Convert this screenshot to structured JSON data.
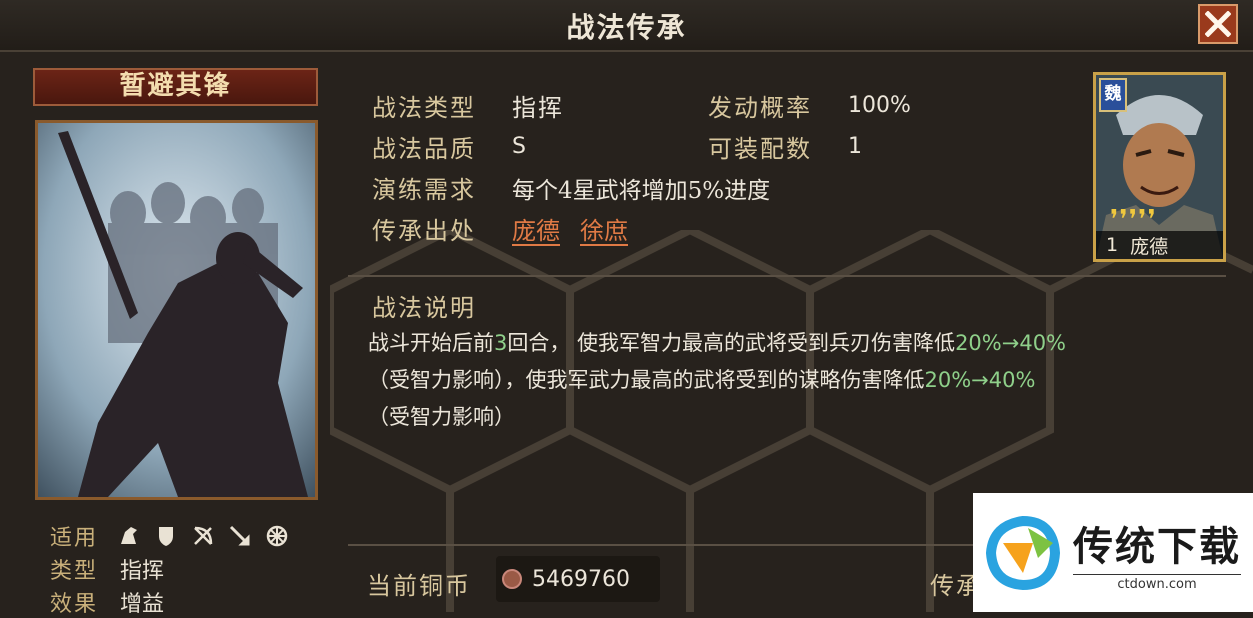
{
  "header": {
    "title": "战法传承"
  },
  "skill": {
    "name": "暂避其锋",
    "fields": {
      "type_label": "战法类型",
      "type_value": "指挥",
      "rate_label": "发动概率",
      "rate_value": "100%",
      "quality_label": "战法品质",
      "quality_value": "S",
      "equip_label": "可装配数",
      "equip_value": "1",
      "practice_label": "演练需求",
      "practice_value": "每个4星武将增加5%进度",
      "source_label": "传承出处",
      "sources": [
        "庞德",
        "徐庶"
      ]
    },
    "meta": {
      "applicable_label": "适用",
      "applicable_icons": [
        "cavalry-icon",
        "shield-icon",
        "bow-icon",
        "spear-icon",
        "siege-icon"
      ],
      "type_label": "类型",
      "type_value": "指挥",
      "effect_label": "效果",
      "effect_value": "增益"
    }
  },
  "general": {
    "faction": "魏",
    "stars": "❜❜❜❜❜",
    "level": "1",
    "name": "庞德"
  },
  "description": {
    "title": "战法说明",
    "part1": "战斗开始后前",
    "rounds": "3",
    "part2": "回合， 使我军智力最高的武将受到兵刃伤害降低",
    "range1": "20%→40%",
    "part3": "（受智力影响），使我军武力最高的武将受到的谋略伤害降低",
    "range2": "20%→40%",
    "part4": "（受智力影响）"
  },
  "footer": {
    "coin_label": "当前铜币",
    "coin_value": "5469760",
    "inherit_button": "传承"
  },
  "watermark": {
    "brand": "传统下载",
    "url": "ctdown.com"
  },
  "colors": {
    "accent_green": "#8fd08a",
    "link_orange": "#e07a45",
    "close_red": "#9a3a1c"
  }
}
